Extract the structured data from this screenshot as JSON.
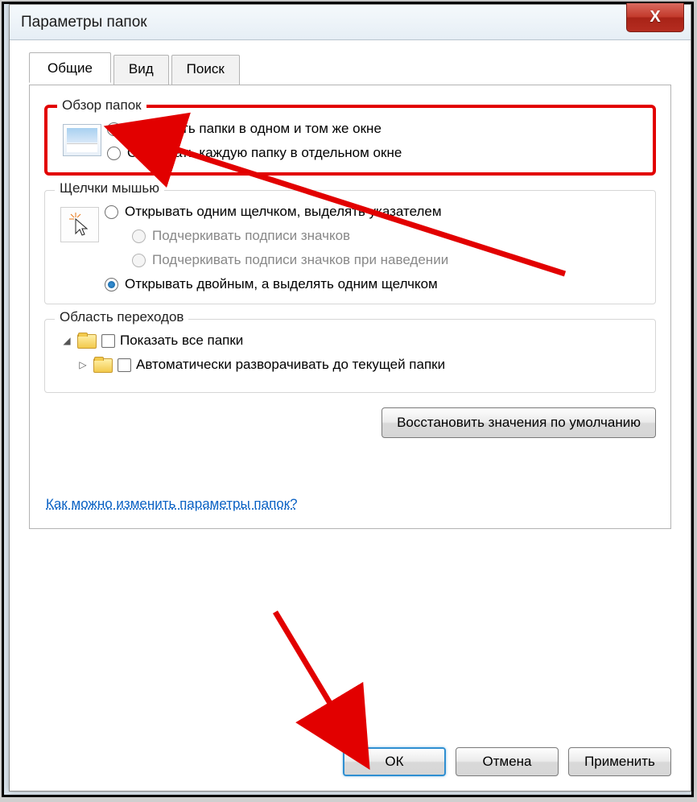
{
  "window": {
    "title": "Параметры папок",
    "close_glyph": "X"
  },
  "tabs": {
    "general": "Общие",
    "view": "Вид",
    "search": "Поиск"
  },
  "browse_group": {
    "title": "Обзор папок",
    "same_window": "Открывать папки в одном и том же окне",
    "own_window": "Открывать каждую папку в отдельном окне"
  },
  "click_group": {
    "title": "Щелчки мышью",
    "single_click": "Открывать одним щелчком, выделять указателем",
    "underline_all": "Подчеркивать подписи значков",
    "underline_hover": "Подчеркивать подписи значков при наведении",
    "double_click": "Открывать двойным, а выделять одним щелчком"
  },
  "nav_group": {
    "title": "Область переходов",
    "show_all": "Показать все папки",
    "auto_expand": "Автоматически разворачивать до текущей папки"
  },
  "restore_defaults": "Восстановить значения по умолчанию",
  "help_link": "Как можно изменить параметры папок?",
  "buttons": {
    "ok": "ОК",
    "cancel": "Отмена",
    "apply": "Применить"
  }
}
